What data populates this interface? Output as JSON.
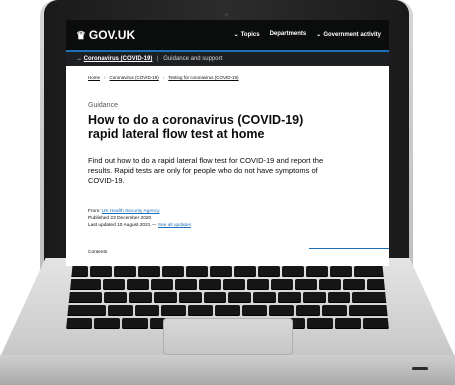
{
  "site": {
    "logo_text": "GOV.UK",
    "nav": [
      "Topics",
      "Departments",
      "Government activity"
    ]
  },
  "topic_bar": {
    "arrow": "→",
    "link": "Coronavirus (COVID-19)",
    "separator": "|",
    "rest": "Guidance and support"
  },
  "breadcrumb": [
    "Home",
    "Coronavirus (COVID-19)",
    "Testing for coronavirus (COVID-19)"
  ],
  "page": {
    "caption": "Guidance",
    "title": "How to do a coronavirus (COVID-19) rapid lateral flow test at home",
    "lead": "Find out how to do a rapid lateral flow test for COVID-19 and report the results. Rapid tests are only for people who do not have symptoms of COVID-19."
  },
  "meta": {
    "from_label": "From:",
    "from_value": "UK Health Security Agency",
    "published": "Published 23 December 2020",
    "updated": "Last updated 10 August 2021 —",
    "see_all": "See all updates"
  },
  "contents_label": "Contents",
  "colors": {
    "header_bg": "#0b0c0c",
    "link_blue": "#1d70b8",
    "text": "#0b0c0c"
  }
}
